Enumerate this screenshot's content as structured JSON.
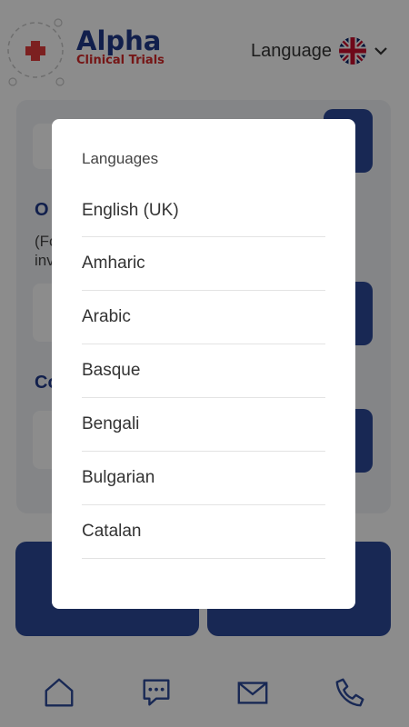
{
  "header": {
    "logo_title": "Alpha",
    "logo_subtitle": "Clinical Trials",
    "language_label": "Language",
    "flag_icon": "uk-flag-icon"
  },
  "background": {
    "partial_heading_1": "O",
    "partial_text_1": "(Fo",
    "partial_text_2": "inv",
    "partial_heading_2": "Co"
  },
  "modal": {
    "title": "Languages",
    "languages": [
      "English (UK)",
      "Amharic",
      "Arabic",
      "Basque",
      "Bengali",
      "Bulgarian",
      "Catalan"
    ]
  },
  "bottom_nav": {
    "items": [
      "home-icon",
      "chat-icon",
      "mail-icon",
      "phone-icon"
    ]
  },
  "colors": {
    "brand_blue": "#1f3a8a",
    "brand_red": "#d62828",
    "button_blue": "#2d4a9a"
  }
}
